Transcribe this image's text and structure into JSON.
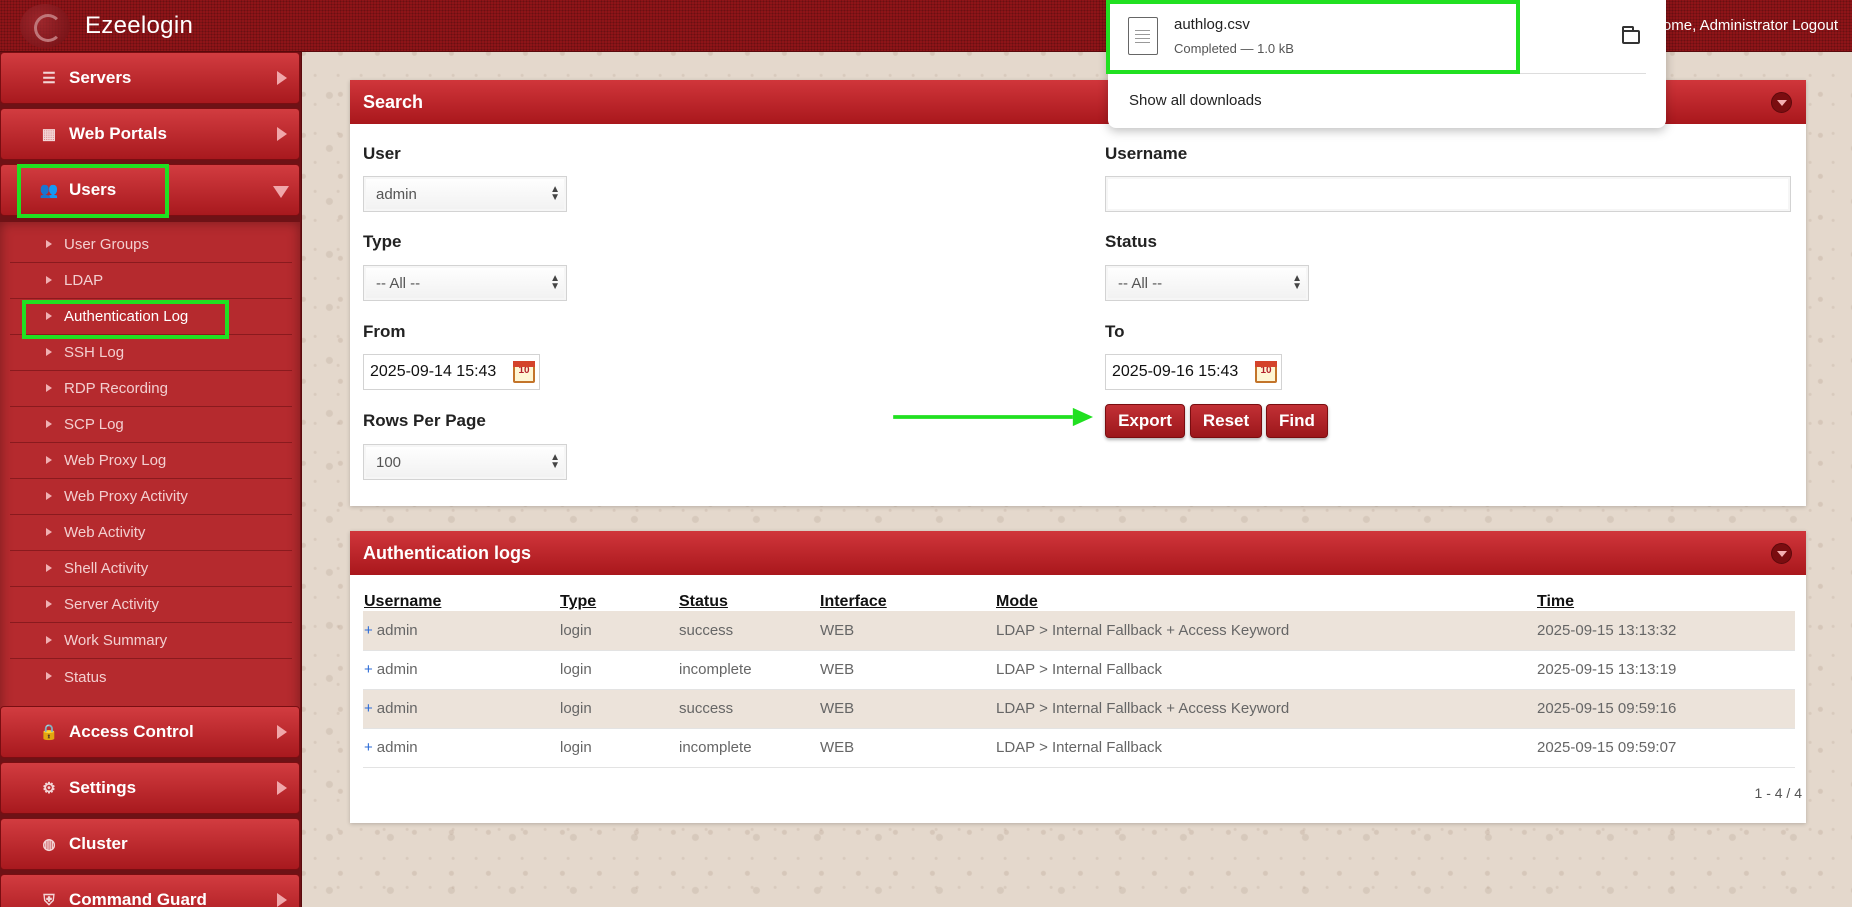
{
  "header": {
    "app_title": "Ezeelogin",
    "welcome_text": "ome, Administrator",
    "logout_label": "Logout"
  },
  "sidebar": {
    "items": [
      {
        "label": "Servers",
        "icon": "list-icon"
      },
      {
        "label": "Web Portals",
        "icon": "dashboard-icon"
      },
      {
        "label": "Users",
        "icon": "users-icon"
      },
      {
        "label": "Access Control",
        "icon": "lock-icon"
      },
      {
        "label": "Settings",
        "icon": "gears-icon"
      },
      {
        "label": "Cluster",
        "icon": "globe-icon"
      },
      {
        "label": "Command Guard",
        "icon": "shield-icon"
      }
    ],
    "sub_items": [
      "User Groups",
      "LDAP",
      "Authentication Log",
      "SSH Log",
      "RDP Recording",
      "SCP Log",
      "Web Proxy Log",
      "Web Proxy Activity",
      "Web Activity",
      "Shell Activity",
      "Server Activity",
      "Work Summary",
      "Status"
    ]
  },
  "search": {
    "title": "Search",
    "user_label": "User",
    "user_value": "admin",
    "username_label": "Username",
    "username_value": "",
    "type_label": "Type",
    "type_value": "-- All --",
    "status_label": "Status",
    "status_value": "-- All --",
    "from_label": "From",
    "from_value": "2025-09-14 15:43",
    "to_label": "To",
    "to_value": "2025-09-16 15:43",
    "rows_label": "Rows Per Page",
    "rows_value": "100",
    "calendar_day": "10",
    "export_label": "Export",
    "reset_label": "Reset",
    "find_label": "Find"
  },
  "logs": {
    "title": "Authentication logs",
    "columns": [
      "Username",
      "Type",
      "Status",
      "Interface",
      "Mode",
      "Time"
    ],
    "rows": [
      {
        "username": "admin",
        "type": "login",
        "status": "success",
        "interface": "WEB",
        "mode": "LDAP > Internal Fallback + Access Keyword",
        "time": "2025-09-15 13:13:32"
      },
      {
        "username": "admin",
        "type": "login",
        "status": "incomplete",
        "interface": "WEB",
        "mode": "LDAP > Internal Fallback",
        "time": "2025-09-15 13:13:19"
      },
      {
        "username": "admin",
        "type": "login",
        "status": "success",
        "interface": "WEB",
        "mode": "LDAP > Internal Fallback + Access Keyword",
        "time": "2025-09-15 09:59:16"
      },
      {
        "username": "admin",
        "type": "login",
        "status": "incomplete",
        "interface": "WEB",
        "mode": "LDAP > Internal Fallback",
        "time": "2025-09-15 09:59:07"
      }
    ],
    "pager": "1 - 4 / 4"
  },
  "downloads": {
    "file_name": "authlog.csv",
    "file_status": "Completed — 1.0 kB",
    "show_all": "Show all downloads"
  },
  "colors": {
    "brand_red": "#a9171c",
    "highlight_green": "#21e021",
    "link_blue": "#2c6bd6"
  }
}
